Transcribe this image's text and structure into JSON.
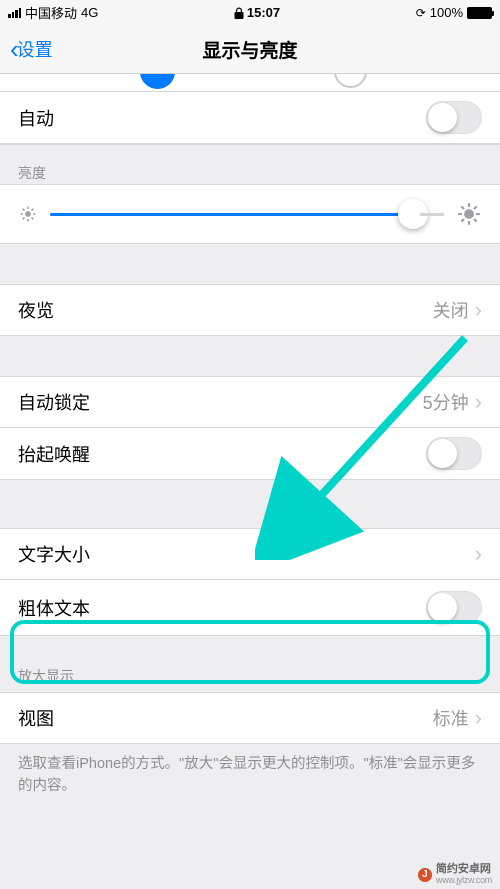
{
  "status": {
    "carrier": "中国移动",
    "network": "4G",
    "time": "15:07",
    "battery": "100%"
  },
  "nav": {
    "back": "设置",
    "title": "显示与亮度"
  },
  "rows": {
    "auto": "自动",
    "night_shift": "夜览",
    "night_shift_val": "关闭",
    "auto_lock": "自动锁定",
    "auto_lock_val": "5分钟",
    "raise_wake": "抬起唤醒",
    "text_size": "文字大小",
    "bold_text": "粗体文本",
    "view": "视图",
    "view_val": "标准"
  },
  "sections": {
    "brightness": "亮度",
    "zoom": "放大显示"
  },
  "footer": "选取查看iPhone的方式。\"放大\"会显示更大的控制项。\"标准\"会显示更多的内容。",
  "watermark": {
    "top": "简约安卓网",
    "bottom": "www.jylzw.com"
  }
}
